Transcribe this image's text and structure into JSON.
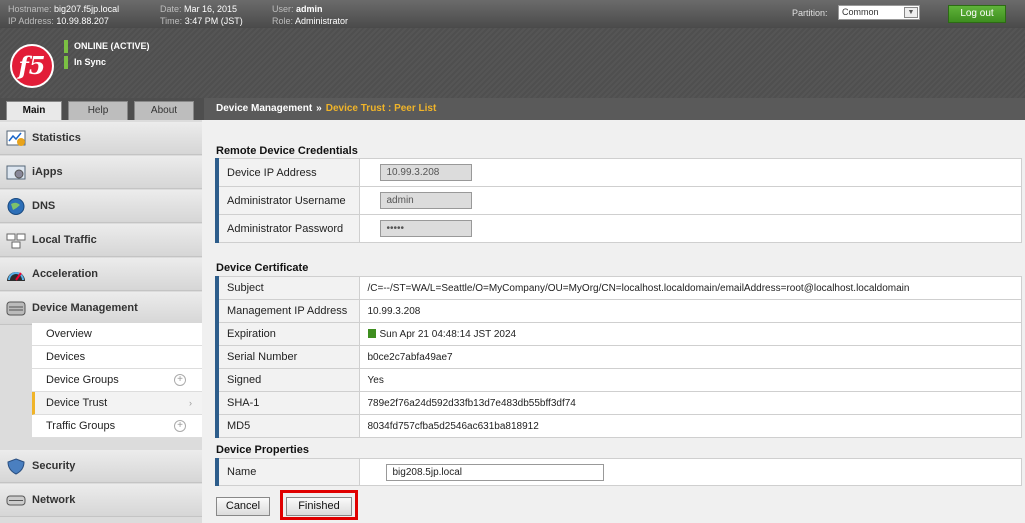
{
  "topbar": {
    "hostname_label": "Hostname:",
    "hostname": "big207.f5jp.local",
    "ip_label": "IP Address:",
    "ip": "10.99.88.207",
    "date_label": "Date:",
    "date": "Mar 16, 2015",
    "time_label": "Time:",
    "time": "3:47 PM (JST)",
    "user_label": "User:",
    "user": "admin",
    "role_label": "Role:",
    "role": "Administrator",
    "partition_label": "Partition:",
    "partition_value": "Common",
    "logout_label": "Log out"
  },
  "brand": {
    "logo_text": "f5",
    "status_online": "ONLINE (ACTIVE)",
    "status_sync": "In Sync"
  },
  "tabs": [
    {
      "label": "Main"
    },
    {
      "label": "Help"
    },
    {
      "label": "About"
    }
  ],
  "breadcrumb": {
    "parent": "Device Management",
    "sep": "»",
    "current": "Device Trust : Peer List"
  },
  "sidebar": {
    "items": [
      {
        "label": "Statistics",
        "icon": "statistics-icon"
      },
      {
        "label": "iApps",
        "icon": "iapps-icon"
      },
      {
        "label": "DNS",
        "icon": "dns-icon"
      },
      {
        "label": "Local Traffic",
        "icon": "local-traffic-icon"
      },
      {
        "label": "Acceleration",
        "icon": "acceleration-icon"
      },
      {
        "label": "Device Management",
        "icon": "device-management-icon"
      },
      {
        "label": "Security",
        "icon": "security-icon"
      },
      {
        "label": "Network",
        "icon": "network-icon"
      }
    ],
    "sub_items": [
      {
        "label": "Overview"
      },
      {
        "label": "Devices"
      },
      {
        "label": "Device Groups"
      },
      {
        "label": "Device Trust"
      },
      {
        "label": "Traffic Groups"
      }
    ]
  },
  "credentials": {
    "title": "Remote Device Credentials",
    "rows": [
      {
        "label": "Device IP Address",
        "value": "10.99.3.208"
      },
      {
        "label": "Administrator Username",
        "value": "admin"
      },
      {
        "label": "Administrator Password",
        "value": "•••••"
      }
    ]
  },
  "certificate": {
    "title": "Device Certificate",
    "rows": [
      {
        "label": "Subject",
        "value": "/C=--/ST=WA/L=Seattle/O=MyCompany/OU=MyOrg/CN=localhost.localdomain/emailAddress=root@localhost.localdomain"
      },
      {
        "label": "Management IP Address",
        "value": "10.99.3.208"
      },
      {
        "label": "Expiration",
        "value": "Sun Apr 21 04:48:14 JST 2024"
      },
      {
        "label": "Serial Number",
        "value": "b0ce2c7abfa49ae7"
      },
      {
        "label": "Signed",
        "value": "Yes"
      },
      {
        "label": "SHA-1",
        "value": "789e2f76a24d592d33fb13d7e483db55bff3df74"
      },
      {
        "label": "MD5",
        "value": "8034fd757cfba5d2546ac631ba818912"
      }
    ]
  },
  "properties": {
    "title": "Device Properties",
    "name_label": "Name",
    "name_value": "big208.5jp.local"
  },
  "buttons": {
    "cancel": "Cancel",
    "finished": "Finished"
  },
  "colors": {
    "accent": "#f0b429",
    "brand": "#e21d38",
    "highlight": "#e00000",
    "key_bar": "#2d5d8b"
  }
}
